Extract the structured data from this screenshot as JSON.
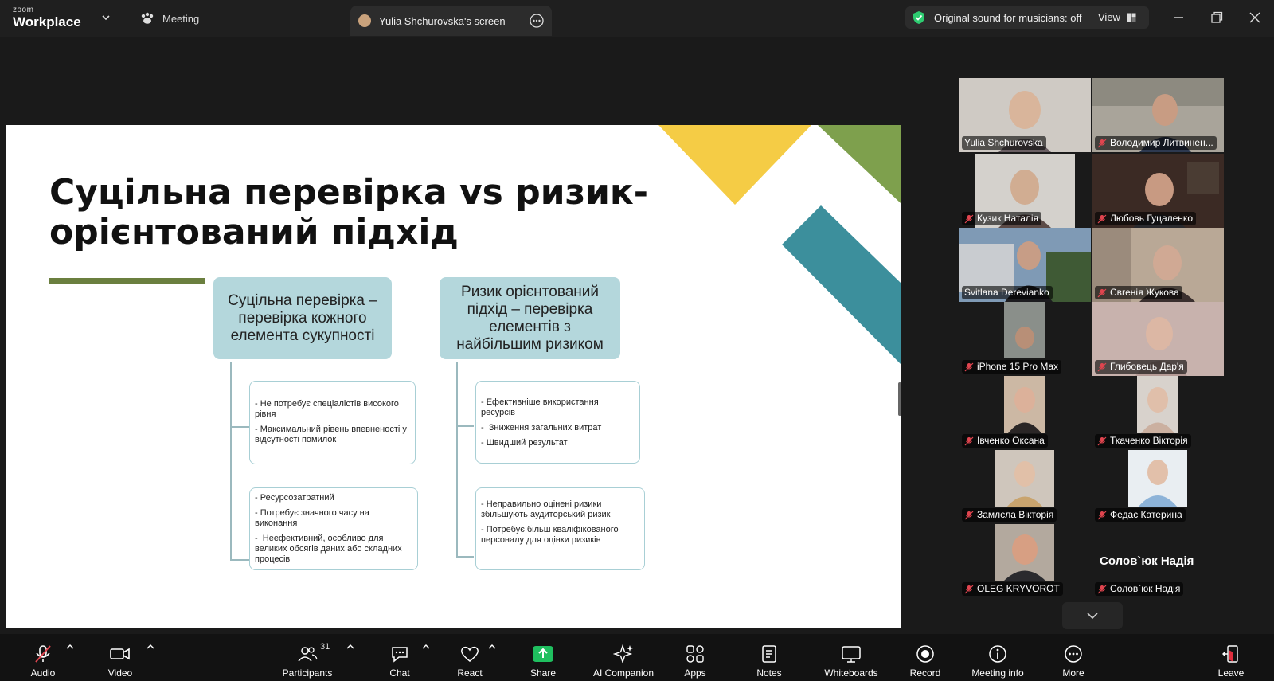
{
  "topbar": {
    "brand_small": "zoom",
    "brand_big": "Workplace",
    "meeting_tab": "Meeting",
    "screen_tab": "Yulia Shchurovska's screen",
    "sound_status": "Original sound for musicians: off",
    "view_label": "View",
    "accent": "#2ecc71"
  },
  "slide": {
    "title_line1": "Суцільна перевірка vs ризик-",
    "title_line2": "орієнтований підхід",
    "left_head": "Суцільна перевірка – перевірка кожного елемента сукупності",
    "right_head": "Ризик орієнтований підхід – перевірка елементів з найбільшим ризиком",
    "left_pros": [
      "- Не потребує спеціалістів високого рівня",
      "- Максимальний рівень впевненості у відсутності помилок"
    ],
    "left_cons": [
      "- Ресурсозатратний",
      "- Потребує значного часу на виконання",
      "-  Неефективний, особливо для великих обсягів даних або складних процесів"
    ],
    "right_pros": [
      "- Ефективніше використання ресурсів",
      "-  Зниження загальних витрат",
      "- Швидший результат"
    ],
    "right_cons": [
      "- Неправильно оцінені ризики збільшують аудиторський ризик",
      "- Потребує більш кваліфікованого персоналу для оцінки ризиків"
    ],
    "colors": {
      "head_fill": "#b4d7dc",
      "rule": "#6b7f3f",
      "yellow": "#f5cc45",
      "olive": "#7ea04d",
      "teal": "#3c8f9c"
    }
  },
  "participants": [
    {
      "name": "Yulia Shchurovska",
      "muted": false,
      "active": true
    },
    {
      "name": "Володимир Литвинен...",
      "muted": true
    },
    {
      "name": "Кузик Наталія",
      "muted": true
    },
    {
      "name": "Любовь Гуцаленко",
      "muted": true
    },
    {
      "name": "Svitlana Derevianko",
      "muted": false
    },
    {
      "name": "Євгенія Жукова",
      "muted": true
    },
    {
      "name": "iPhone 15 Pro Max",
      "muted": true
    },
    {
      "name": "Глибовець Дар'я",
      "muted": true
    },
    {
      "name": "Івченко Оксана",
      "muted": true
    },
    {
      "name": "Ткаченко Вікторія",
      "muted": true
    },
    {
      "name": "Замлєла Вікторія",
      "muted": true
    },
    {
      "name": "Федас Катерина",
      "muted": true
    },
    {
      "name": "OLEG KRYVOROT",
      "muted": true
    },
    {
      "name": "Солов`юк Надія",
      "muted": true
    }
  ],
  "solovyuk_display_name": "Солов`юк Надія",
  "toolbar": {
    "audio": "Audio",
    "video": "Video",
    "participants": "Participants",
    "participants_count": "31",
    "chat": "Chat",
    "react": "React",
    "share": "Share",
    "ai": "AI Companion",
    "apps": "Apps",
    "notes": "Notes",
    "whiteboards": "Whiteboards",
    "record": "Record",
    "info": "Meeting info",
    "more": "More",
    "leave": "Leave",
    "share_color": "#1fbf5f",
    "leave_color": "#e02d3c"
  }
}
